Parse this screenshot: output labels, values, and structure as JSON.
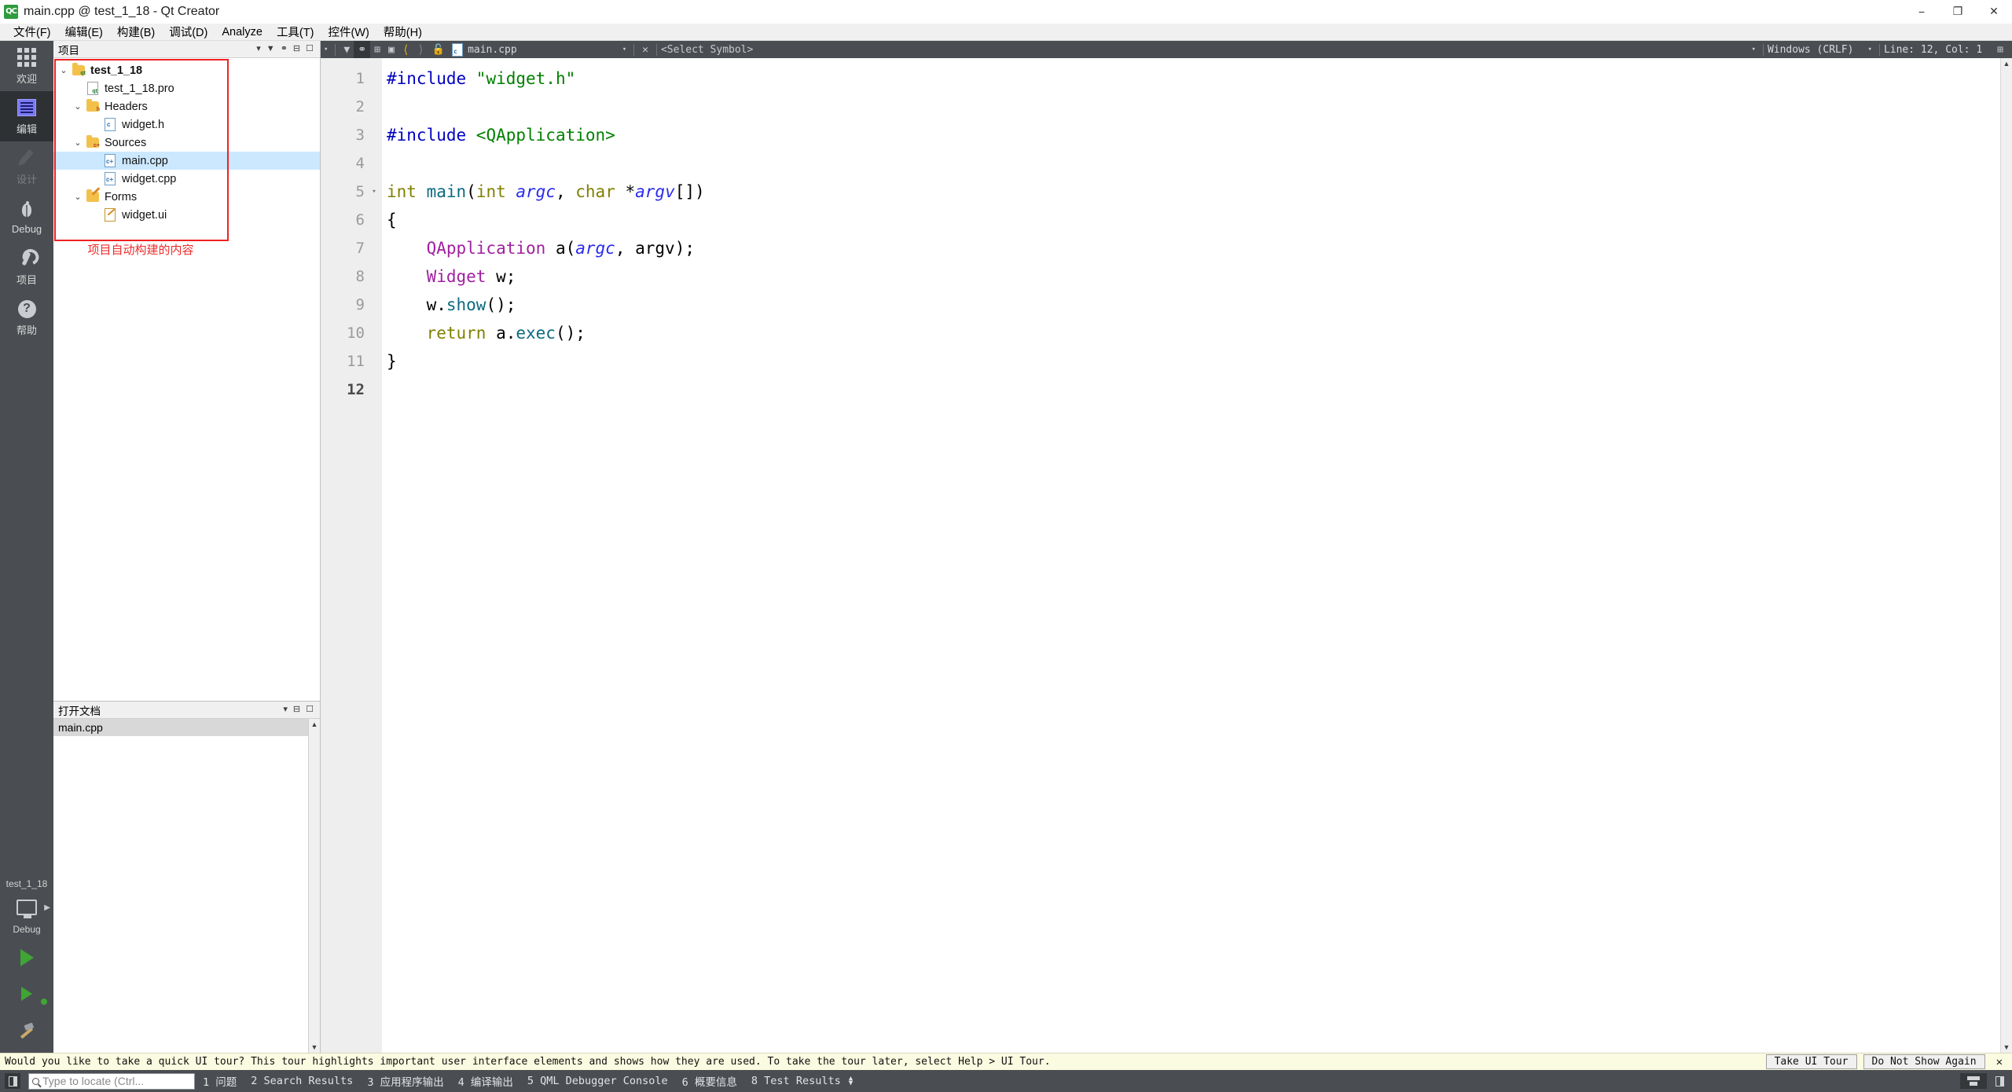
{
  "window": {
    "title": "main.cpp @ test_1_18 - Qt Creator",
    "app_icon": "qt-creator-icon",
    "minimize": "−",
    "maximize": "❐",
    "close": "✕"
  },
  "menubar": {
    "items": [
      {
        "label": "文件(F)",
        "name": "menu-file"
      },
      {
        "label": "编辑(E)",
        "name": "menu-edit"
      },
      {
        "label": "构建(B)",
        "name": "menu-build"
      },
      {
        "label": "调试(D)",
        "name": "menu-debug"
      },
      {
        "label": "Analyze",
        "name": "menu-analyze"
      },
      {
        "label": "工具(T)",
        "name": "menu-tools"
      },
      {
        "label": "控件(W)",
        "name": "menu-window"
      },
      {
        "label": "帮助(H)",
        "name": "menu-help"
      }
    ]
  },
  "modebar": {
    "items": [
      {
        "label": "欢迎",
        "icon": "grid-icon",
        "selected": false,
        "disabled": false
      },
      {
        "label": "编辑",
        "icon": "edit-icon",
        "selected": true,
        "disabled": false
      },
      {
        "label": "设计",
        "icon": "pencil-icon",
        "selected": false,
        "disabled": true
      },
      {
        "label": "Debug",
        "icon": "bug-icon",
        "selected": false,
        "disabled": false
      },
      {
        "label": "项目",
        "icon": "wrench-icon",
        "selected": false,
        "disabled": false
      },
      {
        "label": "帮助",
        "icon": "question-mark-icon",
        "selected": false,
        "disabled": false
      }
    ],
    "kit_name": "test_1_18",
    "kit_mode": "Debug"
  },
  "project_dock": {
    "title": "项目",
    "tools": [
      "filter-dropdown-icon",
      "filter-icon",
      "link-icon",
      "split-icon",
      "close-icon"
    ],
    "tree": [
      {
        "label": "test_1_18",
        "indent": 0,
        "icon": "project-folder-icon",
        "chevron": "⌄",
        "bold": true,
        "selected": false
      },
      {
        "label": "test_1_18.pro",
        "indent": 1,
        "icon": "pro-file-icon",
        "chevron": "",
        "bold": false,
        "selected": false
      },
      {
        "label": "Headers",
        "indent": 1,
        "icon": "headers-folder-icon",
        "chevron": "⌄",
        "bold": false,
        "selected": false
      },
      {
        "label": "widget.h",
        "indent": 2,
        "icon": "header-file-icon",
        "chevron": "",
        "bold": false,
        "selected": false
      },
      {
        "label": "Sources",
        "indent": 1,
        "icon": "sources-folder-icon",
        "chevron": "⌄",
        "bold": false,
        "selected": false
      },
      {
        "label": "main.cpp",
        "indent": 2,
        "icon": "cpp-file-icon",
        "chevron": "",
        "bold": false,
        "selected": true
      },
      {
        "label": "widget.cpp",
        "indent": 2,
        "icon": "cpp-file-icon",
        "chevron": "",
        "bold": false,
        "selected": false
      },
      {
        "label": "Forms",
        "indent": 1,
        "icon": "forms-folder-icon",
        "chevron": "⌄",
        "bold": false,
        "selected": false
      },
      {
        "label": "widget.ui",
        "indent": 2,
        "icon": "ui-file-icon",
        "chevron": "",
        "bold": false,
        "selected": false
      }
    ],
    "annotation": "项目自动构建的内容",
    "annotation_color": "#ee2c2c"
  },
  "opendocs_dock": {
    "title": "打开文档",
    "items": [
      {
        "label": "main.cpp",
        "selected": true
      }
    ]
  },
  "editor_toolbar": {
    "filter_chevron": "▾",
    "filter_icon": "filter-icon",
    "link_icon": "link-icon",
    "split_icon": "split-horizontal-icon",
    "close_split_icon": "close-split-icon",
    "back_icon": "back-arrow-icon",
    "forward_icon": "forward-arrow-icon",
    "lock_icon": "unlocked-icon",
    "file_icon": "cpp-file-icon",
    "filename": "main.cpp",
    "file_chevron": "▾",
    "close_label": "✕",
    "symbol_selector": "<Select Symbol>",
    "line_ending_chevron": "▾",
    "line_ending": "Windows (CRLF)",
    "encoding_chevron": "▾",
    "cursor_position": "Line: 12, Col: 1",
    "split_button_icon": "split-icon"
  },
  "code": {
    "lines": [
      {
        "num": "1",
        "fold": "",
        "current": false,
        "tokens": [
          {
            "t": "#include ",
            "c": "k-pre"
          },
          {
            "t": "\"widget.h\"",
            "c": "k-str"
          }
        ]
      },
      {
        "num": "2",
        "fold": "",
        "current": false,
        "tokens": []
      },
      {
        "num": "3",
        "fold": "",
        "current": false,
        "tokens": [
          {
            "t": "#include ",
            "c": "k-pre"
          },
          {
            "t": "<QApplication>",
            "c": "k-str"
          }
        ]
      },
      {
        "num": "4",
        "fold": "",
        "current": false,
        "tokens": []
      },
      {
        "num": "5",
        "fold": "▾",
        "current": false,
        "tokens": [
          {
            "t": "int ",
            "c": "k-type"
          },
          {
            "t": "main",
            "c": "k-func"
          },
          {
            "t": "(",
            "c": "k-plain"
          },
          {
            "t": "int ",
            "c": "k-type"
          },
          {
            "t": "argc",
            "c": "k-param"
          },
          {
            "t": ", ",
            "c": "k-plain"
          },
          {
            "t": "char ",
            "c": "k-type"
          },
          {
            "t": "*",
            "c": "k-plain"
          },
          {
            "t": "argv",
            "c": "k-param"
          },
          {
            "t": "[])",
            "c": "k-plain"
          }
        ]
      },
      {
        "num": "6",
        "fold": "",
        "current": false,
        "tokens": [
          {
            "t": "{",
            "c": "k-plain"
          }
        ]
      },
      {
        "num": "7",
        "fold": "",
        "current": false,
        "tokens": [
          {
            "t": "    ",
            "c": "k-plain"
          },
          {
            "t": "QApplication",
            "c": "k-class"
          },
          {
            "t": " a(",
            "c": "k-plain"
          },
          {
            "t": "argc",
            "c": "k-param"
          },
          {
            "t": ", ",
            "c": "k-plain"
          },
          {
            "t": "argv",
            "c": "k-plain"
          },
          {
            "t": ");",
            "c": "k-plain"
          }
        ]
      },
      {
        "num": "8",
        "fold": "",
        "current": false,
        "tokens": [
          {
            "t": "    ",
            "c": "k-plain"
          },
          {
            "t": "Widget",
            "c": "k-class"
          },
          {
            "t": " w;",
            "c": "k-plain"
          }
        ]
      },
      {
        "num": "9",
        "fold": "",
        "current": false,
        "tokens": [
          {
            "t": "    w.",
            "c": "k-plain"
          },
          {
            "t": "show",
            "c": "k-func"
          },
          {
            "t": "();",
            "c": "k-plain"
          }
        ]
      },
      {
        "num": "10",
        "fold": "",
        "current": false,
        "tokens": [
          {
            "t": "    ",
            "c": "k-plain"
          },
          {
            "t": "return",
            "c": "k-type"
          },
          {
            "t": " a.",
            "c": "k-plain"
          },
          {
            "t": "exec",
            "c": "k-func"
          },
          {
            "t": "();",
            "c": "k-plain"
          }
        ]
      },
      {
        "num": "11",
        "fold": "",
        "current": false,
        "tokens": [
          {
            "t": "}",
            "c": "k-plain"
          }
        ]
      },
      {
        "num": "12",
        "fold": "",
        "current": true,
        "tokens": []
      }
    ]
  },
  "tour_banner": {
    "message": "Would you like to take a quick UI tour? This tour highlights important user interface elements and shows how they are used. To take the tour later, select Help > UI Tour.",
    "take_tour": "Take UI Tour",
    "do_not_show": "Do Not Show Again",
    "close": "✕"
  },
  "statusbar": {
    "sidebar_toggle": "sidebar-toggle-icon",
    "locator_placeholder": "Type to locate (Ctrl...",
    "panes": [
      "1 问题",
      "2 Search Results",
      "3 应用程序输出",
      "4 编译输出",
      "5 QML Debugger Console",
      "6 概要信息",
      "8 Test Results"
    ],
    "updown": "⇅",
    "progress_icon": "progress-icon",
    "right_toggle": "output-toggle-icon"
  }
}
